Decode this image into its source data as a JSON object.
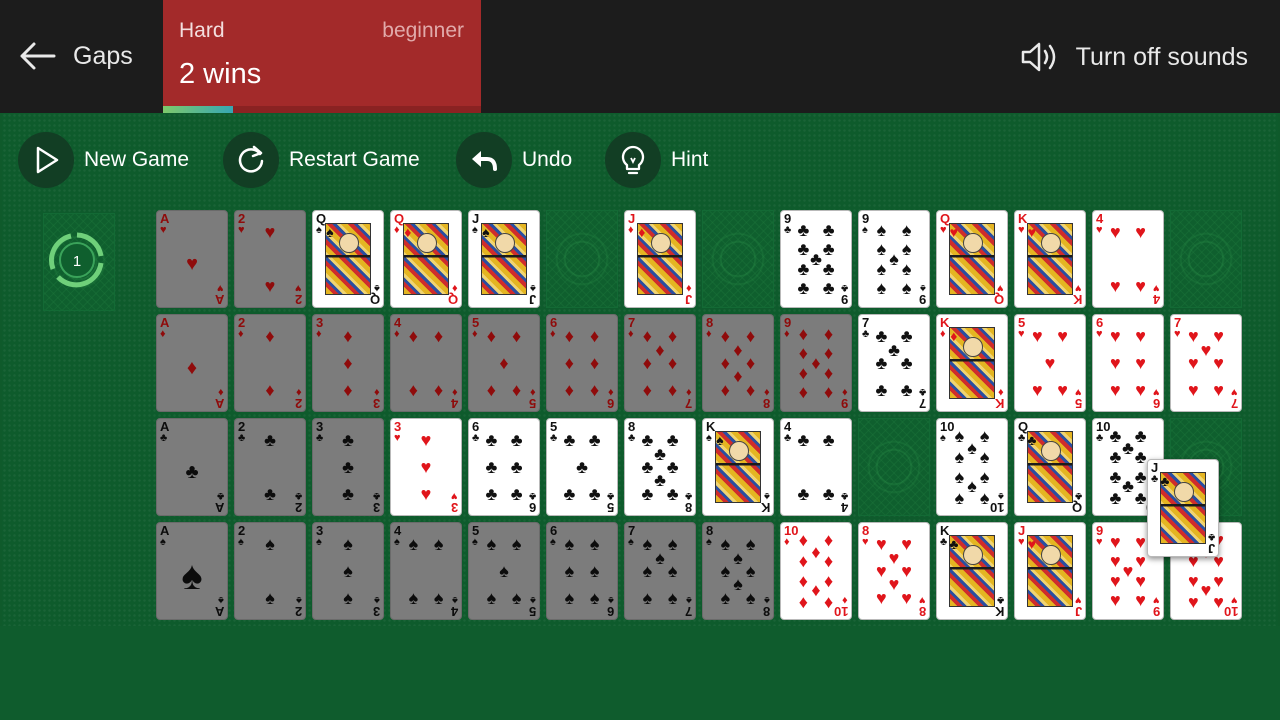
{
  "header": {
    "back_icon": "arrow-left-icon",
    "title": "Gaps",
    "difficulty": "Hard",
    "rank": "beginner",
    "wins": "2 wins",
    "progress_fraction": 0.22,
    "sound_icon": "speaker-icon",
    "sound_label": "Turn off sounds"
  },
  "toolbar": {
    "new_game": "New Game",
    "restart_game": "Restart Game",
    "undo": "Undo",
    "hint": "Hint"
  },
  "deck": {
    "redeals": "1"
  },
  "colors": {
    "felt": "#0e5b2c",
    "difficulty_bg": "#a32a2a",
    "topbar": "#1c1c1c"
  },
  "rows": [
    [
      "A♥",
      "2♥",
      "Q♠",
      "Q♦",
      "J♠",
      "",
      "J♦",
      "",
      "9♣",
      "9♠",
      "Q♥",
      "K♥",
      "4♥",
      ""
    ],
    [
      "A♦",
      "2♦",
      "3♦",
      "4♦",
      "5♦",
      "6♦",
      "7♦",
      "8♦",
      "9♦",
      "7♣",
      "K♦",
      "5♥",
      "6♥",
      "7♥"
    ],
    [
      "A♣",
      "2♣",
      "3♣",
      "3♥",
      "6♣",
      "5♣",
      "8♣",
      "K♠",
      "4♣",
      "",
      "10♠",
      "Q♣",
      "10♣",
      ""
    ],
    [
      "A♠",
      "2♠",
      "3♠",
      "4♠",
      "5♠",
      "6♠",
      "7♠",
      "8♠",
      "10♦",
      "8♥",
      "K♣",
      "J♥",
      "9♥",
      "10♥"
    ]
  ],
  "locked": [
    [
      true,
      true,
      false,
      false,
      false,
      false,
      false,
      false,
      false,
      false,
      false,
      false,
      false,
      false
    ],
    [
      true,
      true,
      true,
      true,
      true,
      true,
      true,
      true,
      true,
      false,
      false,
      false,
      false,
      false
    ],
    [
      true,
      true,
      true,
      false,
      false,
      false,
      false,
      false,
      false,
      false,
      false,
      false,
      false,
      false
    ],
    [
      true,
      true,
      true,
      true,
      true,
      true,
      true,
      true,
      false,
      false,
      false,
      false,
      false,
      false
    ]
  ],
  "dragged_card": "J♣"
}
